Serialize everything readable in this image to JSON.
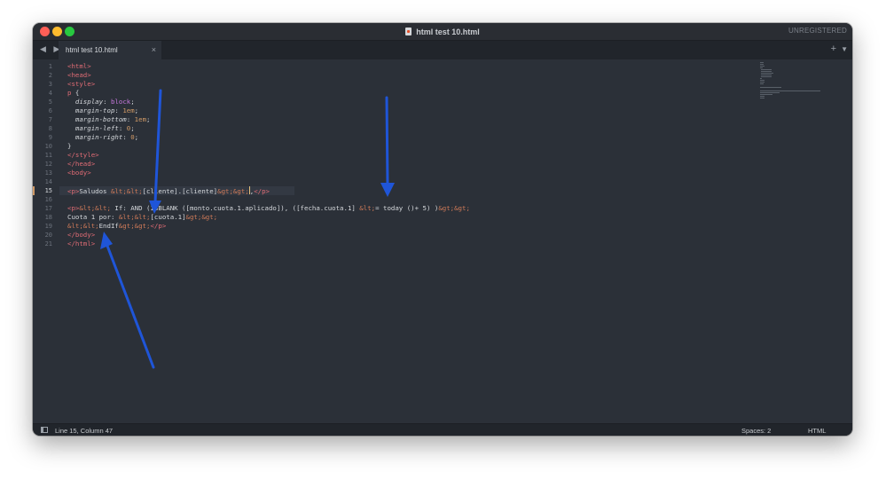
{
  "window": {
    "title": "html test 10.html",
    "license": "UNREGISTERED",
    "icons": {
      "traffic": [
        "close-icon",
        "minimize-icon",
        "maximize-icon"
      ],
      "file": "html-file-icon",
      "nav": [
        "chevron-left-icon",
        "chevron-right-icon"
      ],
      "tab_close": "close-icon",
      "new_tab": "plus-icon",
      "tab_menu": "chevron-down-icon",
      "panel": "panel-toggle-icon"
    },
    "colors": {
      "close": "#ff5f57",
      "minimize": "#febc2e",
      "maximize": "#28c840",
      "background": "#2b3038",
      "arrow": "#1f55d8"
    }
  },
  "tab": {
    "label": "html test 10.html",
    "close_glyph": "×",
    "nav_glyphs": "◀ ▶",
    "plus_glyph": "+",
    "menu_glyph": "▼"
  },
  "editor": {
    "active_line": 15,
    "line_numbers": [
      "1",
      "2",
      "3",
      "4",
      "5",
      "6",
      "7",
      "8",
      "9",
      "10",
      "11",
      "12",
      "13",
      "14",
      "15",
      "16",
      "17",
      "18",
      "19",
      "20",
      "21"
    ],
    "code": {
      "l1": "<html>",
      "l2": "<head>",
      "l3": "<style>",
      "l4_sel": "p",
      "l4_brace": " {",
      "l5_prop": "display",
      "l5_val": "block",
      "l6_prop": "margin-top",
      "l6_val": "1em",
      "l7_prop": "margin-bottom",
      "l7_val": "1em",
      "l8_prop": "margin-left",
      "l8_val": "0",
      "l9_prop": "margin-right",
      "l9_val": "0",
      "l10": "}",
      "l11": "</style>",
      "l12": "</head>",
      "l13": "<body>",
      "l15_open": "<p>",
      "l15_text": "Saludos ",
      "l15_ent1": "&lt;&lt;",
      "l15_mid": "[cliente].[cliente]",
      "l15_ent2": "&gt;&gt;",
      "l15_after": ",",
      "l15_close": "</p>",
      "l17_open": "<p>",
      "l17_ent1": "&lt;&lt;",
      "l17_mid": " If: AND (ISBLANK ([monto.cuota.1.aplicado]), ([fecha.cuota.1] ",
      "l17_ent2": "&lt;",
      "l17_mid2": "= today ()+ 5) )",
      "l17_ent3": "&gt;&gt;",
      "l18_text": "Cuota 1 por: ",
      "l18_ent1": "&lt;&lt;",
      "l18_mid": "[cuota.1]",
      "l18_ent2": "&gt;&gt;",
      "l19_ent1": "&lt;&lt;",
      "l19_mid": "EndIf",
      "l19_ent2": "&gt;&gt;",
      "l19_close": "</p>",
      "l20": "</body>",
      "l21": "</html>"
    }
  },
  "status": {
    "position": "Line 15, Column 47",
    "spaces": "Spaces: 2",
    "syntax": "HTML"
  }
}
